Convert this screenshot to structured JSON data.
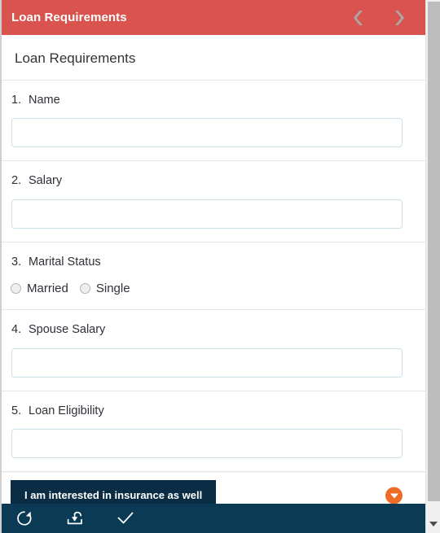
{
  "header": {
    "title": "Loan Requirements",
    "prev_icon": "chevron-left-icon",
    "next_icon": "chevron-right-icon"
  },
  "page": {
    "heading": "Loan Requirements"
  },
  "questions": [
    {
      "number": "1.",
      "label": "Name",
      "type": "text",
      "value": "",
      "placeholder": ""
    },
    {
      "number": "2.",
      "label": "Salary",
      "type": "text",
      "value": "",
      "placeholder": ""
    },
    {
      "number": "3.",
      "label": "Marital Status",
      "type": "radio",
      "options": [
        {
          "label": "Married",
          "selected": false
        },
        {
          "label": "Single",
          "selected": false
        }
      ]
    },
    {
      "number": "4.",
      "label": "Spouse Salary",
      "type": "text",
      "value": "",
      "placeholder": ""
    },
    {
      "number": "5.",
      "label": "Loan Eligibility",
      "type": "text",
      "value": "",
      "placeholder": ""
    }
  ],
  "actions": {
    "interest_button_label": "I am interested in insurance as well",
    "dropdown_icon": "caret-down-icon"
  },
  "toolbar": {
    "items": [
      {
        "icon": "refresh-icon",
        "name": "refresh-button"
      },
      {
        "icon": "restore-upload-icon",
        "name": "restore-button"
      },
      {
        "icon": "checkmark-icon",
        "name": "submit-button"
      }
    ]
  },
  "scrollbar": {
    "down_arrow_icon": "scroll-down-arrow-icon"
  },
  "colors": {
    "header_red": "#d9544f",
    "toolbar_navy": "#0a3a54",
    "button_navy": "#0a2c44",
    "accent_orange": "#ef6c26",
    "input_border": "#cfdfe8",
    "divider": "#e6e6e6"
  }
}
